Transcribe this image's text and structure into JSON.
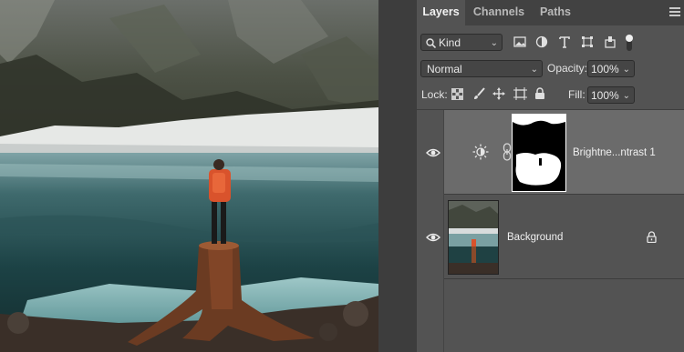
{
  "panel": {
    "tabs": [
      {
        "label": "Layers",
        "active": true
      },
      {
        "label": "Channels",
        "active": false
      },
      {
        "label": "Paths",
        "active": false
      }
    ],
    "menu_icon": "hamburger-menu-icon",
    "filter": {
      "label": "Kind",
      "icon": "search-icon"
    },
    "filter_icons": [
      "pixel-filter-icon",
      "adjustment-filter-icon",
      "type-filter-icon",
      "shape-filter-icon",
      "smart-object-filter-icon",
      "filter-toggle-icon"
    ],
    "blend_mode": "Normal",
    "opacity_label": "Opacity:",
    "opacity_value": "100%",
    "lock_label": "Lock:",
    "lock_icons": [
      "lock-transparent-pixels-icon",
      "lock-image-pixels-icon",
      "lock-position-icon",
      "lock-artboard-icon",
      "lock-all-icon"
    ],
    "fill_label": "Fill:",
    "fill_value": "100%"
  },
  "layers": [
    {
      "name": "Brightne...ntrast 1",
      "type": "adjustment",
      "adjustment_icon": "brightness-sun-icon",
      "linked": true,
      "visible": true,
      "selected": true
    },
    {
      "name": "Background",
      "type": "pixel",
      "locked": true,
      "visible": true,
      "selected": false
    }
  ],
  "colors": {
    "panel_bg": "#535353",
    "tab_bar_bg": "#424242",
    "selected_layer_bg": "#6b6b6b",
    "field_bg": "#454545"
  }
}
